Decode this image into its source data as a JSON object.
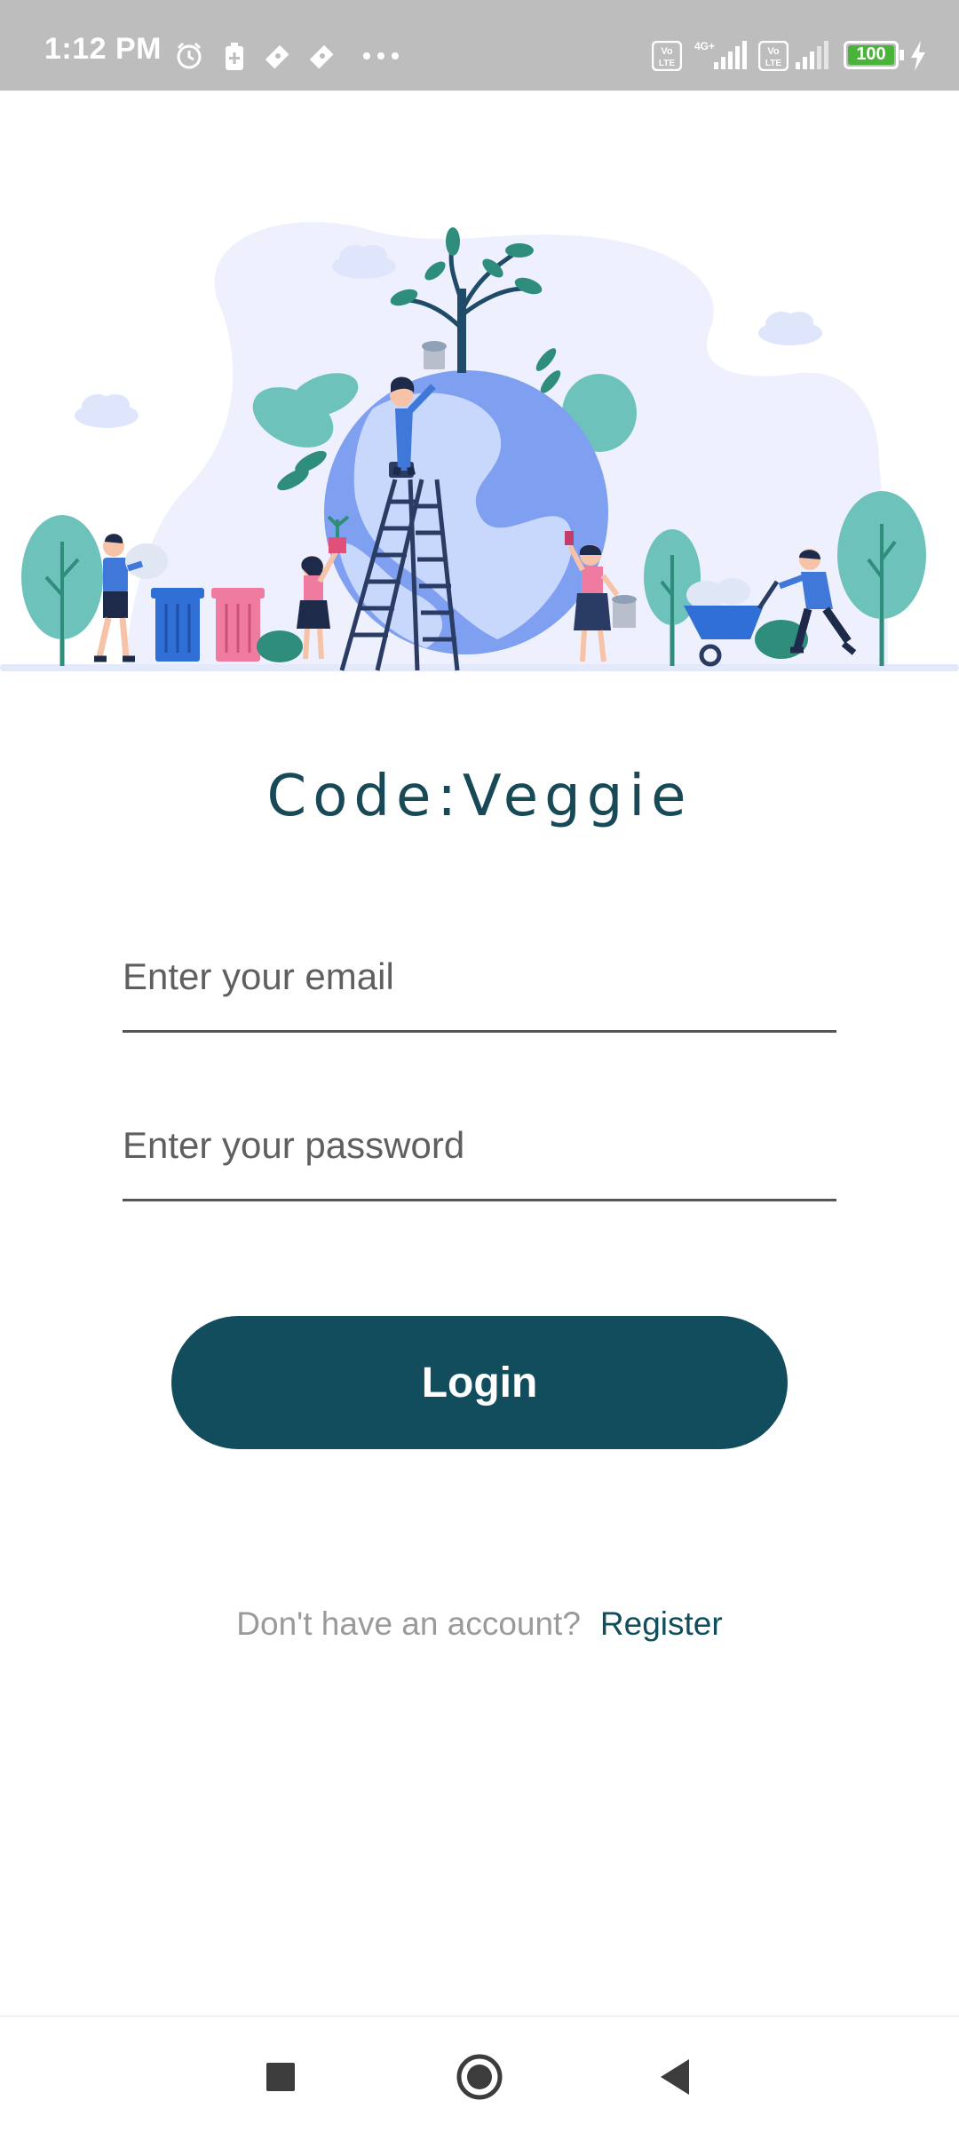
{
  "status_bar": {
    "time": "1:12 PM",
    "battery_level": "100",
    "icons": [
      "alarm-icon",
      "battery-saver-icon",
      "ticket-icon",
      "ticket-icon",
      "more-dots-icon",
      "volte-icon",
      "4g-signal-icon",
      "volte-icon",
      "signal-icon",
      "battery-icon",
      "charging-icon"
    ]
  },
  "app": {
    "title": "Code:Veggie"
  },
  "login_form": {
    "email_placeholder": "Enter your email",
    "password_placeholder": "Enter your password",
    "login_label": "Login"
  },
  "footer": {
    "prompt": "Don't have an account?",
    "register_label": "Register"
  },
  "colors": {
    "primary": "#114d5c",
    "title": "#174957",
    "status_bar": "#bdbdbd",
    "muted_text": "#9a9a9a"
  },
  "nav_bar": {
    "icons": [
      "recents-square-icon",
      "home-circle-icon",
      "back-triangle-icon"
    ]
  }
}
